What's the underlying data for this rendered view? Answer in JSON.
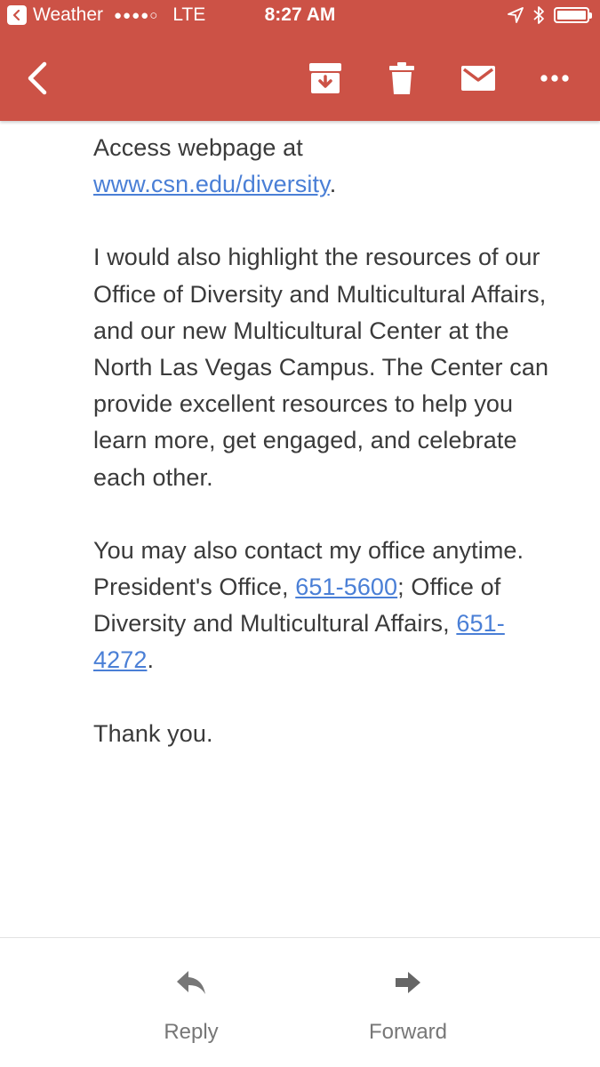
{
  "status_bar": {
    "back_app": "Weather",
    "signal": "●●●●○",
    "carrier": "LTE",
    "time": "8:27 AM"
  },
  "toolbar": {
    "icons": [
      "back-arrow-icon",
      "archive-icon",
      "trash-icon",
      "mail-icon",
      "more-icon"
    ],
    "color": "#cc5246"
  },
  "email": {
    "p1_text": "Access webpage at",
    "p1_link": "www.csn.edu/diversity",
    "p1_end": ".",
    "p2_text": "I would also highlight the resources of our Office of Diversity and Multicultural Affairs, and our new Multicultural Center at the North Las Vegas Campus.  The Center can provide excellent resources to help you learn more, get engaged, and celebrate each other.",
    "p3_text_a": "You may also contact my office anytime.  President's Office,",
    "p3_link_a": "651-5600",
    "p3_text_b": "; Office of Diversity and Multicultural Affairs,",
    "p3_link_b": "651-4272",
    "p3_end": ".",
    "p4_text": "Thank you.",
    "link_color": "#4a7fd6"
  },
  "bottom_bar": {
    "reply_label": "Reply",
    "forward_label": "Forward"
  }
}
